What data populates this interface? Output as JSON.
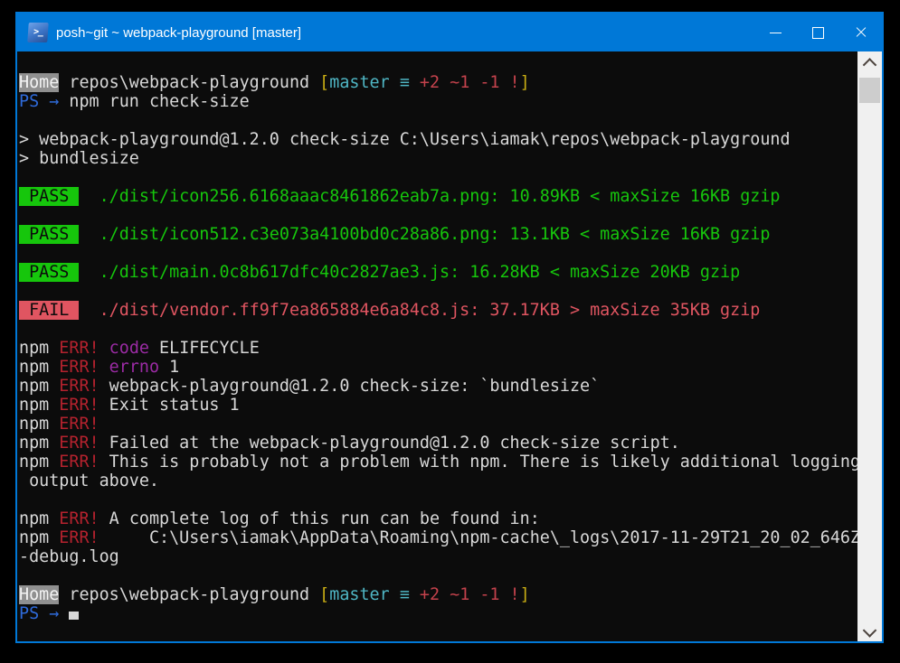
{
  "window": {
    "title": "posh~git ~ webpack-playground [master]",
    "icon_glyph": ">_",
    "controls": {
      "minimize": "minimize-icon",
      "maximize": "maximize-icon",
      "close": "close-icon"
    }
  },
  "palette": {
    "titlebar_bg": "#0078d7",
    "titlebar_text": "#ffffff",
    "background": "#0c0c0c",
    "foreground": "#d8d8d8",
    "err_red": "#b5222e",
    "bright_red": "#e05561",
    "prompt_red": "#c4424c",
    "green": "#16c60c",
    "magenta": "#9b2ba4",
    "yellow": "#c9ad14",
    "cyan": "#4fb6c4",
    "blue": "#2f6bdb",
    "badge_text": "#0c0c0c",
    "home_badge_bg": "#909090",
    "home_badge_text": "#f4f4f4",
    "scrollbar_track": "#f0f0f0",
    "scrollbar_thumb": "#cdcdcd"
  },
  "terminal": {
    "lines": [
      {
        "segments": [
          {
            "c": "homeBadge",
            "t": "Home"
          },
          {
            "c": "fg",
            "t": " repos\\webpack-playground "
          },
          {
            "c": "yellow",
            "t": "["
          },
          {
            "c": "cyan",
            "t": "master ≡ "
          },
          {
            "c": "promptRed",
            "t": "+2 ~1 -1 !"
          },
          {
            "c": "yellow",
            "t": "]"
          }
        ]
      },
      {
        "segments": [
          {
            "c": "blue",
            "t": "PS → "
          },
          {
            "c": "fg",
            "t": "npm run check-size"
          }
        ]
      },
      {
        "segments": []
      },
      {
        "segments": [
          {
            "c": "fg",
            "t": "> webpack-playground@1.2.0 check-size C:\\Users\\iamak\\repos\\webpack-playground"
          }
        ]
      },
      {
        "segments": [
          {
            "c": "fg",
            "t": "> bundlesize"
          }
        ]
      },
      {
        "segments": []
      },
      {
        "segments": [
          {
            "c": "passBadge",
            "t": " PASS "
          },
          {
            "c": "green",
            "t": "  ./dist/icon256.6168aaac8461862eab7a.png: 10.89KB < maxSize 16KB gzip"
          }
        ]
      },
      {
        "segments": []
      },
      {
        "segments": [
          {
            "c": "passBadge",
            "t": " PASS "
          },
          {
            "c": "green",
            "t": "  ./dist/icon512.c3e073a4100bd0c28a86.png: 13.1KB < maxSize 16KB gzip"
          }
        ]
      },
      {
        "segments": []
      },
      {
        "segments": [
          {
            "c": "passBadge",
            "t": " PASS "
          },
          {
            "c": "green",
            "t": "  ./dist/main.0c8b617dfc40c2827ae3.js: 16.28KB < maxSize 20KB gzip"
          }
        ]
      },
      {
        "segments": []
      },
      {
        "segments": [
          {
            "c": "failBadge",
            "t": " FAIL "
          },
          {
            "c": "red",
            "t": "  ./dist/vendor.ff9f7ea865884e6a84c8.js: 37.17KB > maxSize 35KB gzip"
          }
        ]
      },
      {
        "segments": []
      },
      {
        "segments": [
          {
            "c": "fg",
            "t": "npm "
          },
          {
            "c": "errRed",
            "t": "ERR! "
          },
          {
            "c": "magenta",
            "t": "code "
          },
          {
            "c": "fg",
            "t": "ELIFECYCLE"
          }
        ]
      },
      {
        "segments": [
          {
            "c": "fg",
            "t": "npm "
          },
          {
            "c": "errRed",
            "t": "ERR! "
          },
          {
            "c": "magenta",
            "t": "errno "
          },
          {
            "c": "fg",
            "t": "1"
          }
        ]
      },
      {
        "segments": [
          {
            "c": "fg",
            "t": "npm "
          },
          {
            "c": "errRed",
            "t": "ERR! "
          },
          {
            "c": "fg",
            "t": "webpack-playground@1.2.0 check-size: `bundlesize`"
          }
        ]
      },
      {
        "segments": [
          {
            "c": "fg",
            "t": "npm "
          },
          {
            "c": "errRed",
            "t": "ERR! "
          },
          {
            "c": "fg",
            "t": "Exit status 1"
          }
        ]
      },
      {
        "segments": [
          {
            "c": "fg",
            "t": "npm "
          },
          {
            "c": "errRed",
            "t": "ERR!"
          }
        ]
      },
      {
        "segments": [
          {
            "c": "fg",
            "t": "npm "
          },
          {
            "c": "errRed",
            "t": "ERR! "
          },
          {
            "c": "fg",
            "t": "Failed at the webpack-playground@1.2.0 check-size script."
          }
        ]
      },
      {
        "segments": [
          {
            "c": "fg",
            "t": "npm "
          },
          {
            "c": "errRed",
            "t": "ERR! "
          },
          {
            "c": "fg",
            "t": "This is probably not a problem with npm. There is likely additional logging"
          }
        ]
      },
      {
        "segments": [
          {
            "c": "fg",
            "t": " output above."
          }
        ]
      },
      {
        "segments": []
      },
      {
        "segments": [
          {
            "c": "fg",
            "t": "npm "
          },
          {
            "c": "errRed",
            "t": "ERR! "
          },
          {
            "c": "fg",
            "t": "A complete log of this run can be found in:"
          }
        ]
      },
      {
        "segments": [
          {
            "c": "fg",
            "t": "npm "
          },
          {
            "c": "errRed",
            "t": "ERR!"
          },
          {
            "c": "fg",
            "t": "     C:\\Users\\iamak\\AppData\\Roaming\\npm-cache\\_logs\\2017-11-29T21_20_02_646Z"
          }
        ]
      },
      {
        "segments": [
          {
            "c": "fg",
            "t": "-debug.log"
          }
        ]
      },
      {
        "segments": []
      },
      {
        "segments": [
          {
            "c": "homeBadge",
            "t": "Home"
          },
          {
            "c": "fg",
            "t": " repos\\webpack-playground "
          },
          {
            "c": "yellow",
            "t": "["
          },
          {
            "c": "cyan",
            "t": "master ≡ "
          },
          {
            "c": "promptRed",
            "t": "+2 ~1 -1 !"
          },
          {
            "c": "yellow",
            "t": "]"
          }
        ]
      },
      {
        "segments": [
          {
            "c": "blue",
            "t": "PS → "
          },
          {
            "c": "cursor",
            "t": " "
          }
        ]
      }
    ]
  }
}
